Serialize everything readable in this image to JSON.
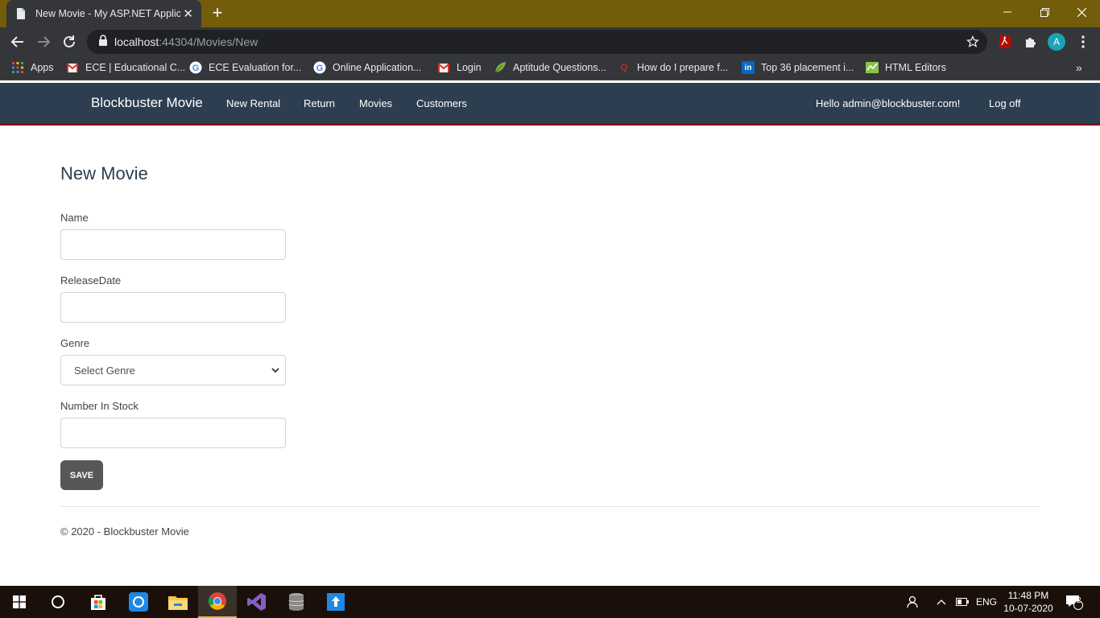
{
  "browser": {
    "tab_title": "New Movie - My ASP.NET Applic",
    "url_host": "localhost",
    "url_rest": ":44304/Movies/New",
    "profile_initial": "A"
  },
  "bookmarks": [
    {
      "label": "Apps",
      "icon": "apps-grid-icon"
    },
    {
      "label": "ECE | Educational C...",
      "icon": "gmail-icon"
    },
    {
      "label": "ECE Evaluation for...",
      "icon": "google-icon"
    },
    {
      "label": "Online Application...",
      "icon": "google-icon"
    },
    {
      "label": "Login",
      "icon": "gmail-icon"
    },
    {
      "label": "Aptitude Questions...",
      "icon": "leaf-icon"
    },
    {
      "label": "How do I prepare f...",
      "icon": "quora-icon"
    },
    {
      "label": "Top 36 placement i...",
      "icon": "linkedin-icon"
    },
    {
      "label": "HTML Editors",
      "icon": "chart-icon"
    }
  ],
  "site": {
    "brand": "Blockbuster Movie",
    "nav": [
      "New Rental",
      "Return",
      "Movies",
      "Customers"
    ],
    "greeting": "Hello admin@blockbuster.com!",
    "logoff": "Log off"
  },
  "form": {
    "title": "New Movie",
    "name_label": "Name",
    "name_value": "",
    "release_label": "ReleaseDate",
    "release_value": "",
    "genre_label": "Genre",
    "genre_selected": "Select Genre",
    "stock_label": "Number In Stock",
    "stock_value": "",
    "save_label": "SAVE"
  },
  "footer": {
    "text": "© 2020 - Blockbuster Movie"
  },
  "taskbar": {
    "language": "ENG",
    "time": "11:48 PM",
    "date": "10-07-2020",
    "notification_count": "2"
  },
  "colors": {
    "titlebar": "#735c0a",
    "navbar": "#2c3e50",
    "navbar_border": "#7a1414",
    "save_button": "#575757"
  }
}
